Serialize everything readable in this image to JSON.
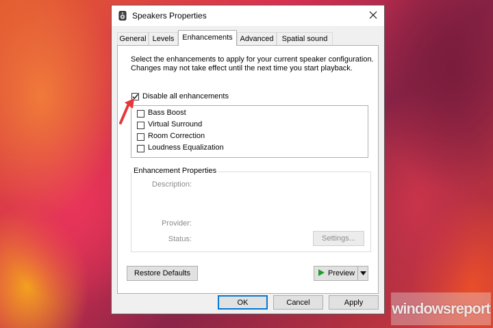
{
  "window": {
    "title": "Speakers Properties",
    "icon": "speaker-icon",
    "close_icon": "close-icon"
  },
  "tabs": [
    {
      "label": "General",
      "active": false
    },
    {
      "label": "Levels",
      "active": false
    },
    {
      "label": "Enhancements",
      "active": true
    },
    {
      "label": "Advanced",
      "active": false
    },
    {
      "label": "Spatial sound",
      "active": false
    }
  ],
  "enhancements": {
    "description": "Select the enhancements to apply for your current speaker configuration. Changes may not take effect until the next time you start playback.",
    "disable_all": {
      "label": "Disable all enhancements",
      "checked": true
    },
    "items": [
      {
        "label": "Bass Boost",
        "checked": false
      },
      {
        "label": "Virtual Surround",
        "checked": false
      },
      {
        "label": "Room Correction",
        "checked": false
      },
      {
        "label": "Loudness Equalization",
        "checked": false
      }
    ]
  },
  "properties": {
    "legend": "Enhancement Properties",
    "description_label": "Description:",
    "provider_label": "Provider:",
    "status_label": "Status:",
    "settings_button": "Settings..."
  },
  "buttons": {
    "restore_defaults": "Restore Defaults",
    "preview": "Preview",
    "ok": "OK",
    "cancel": "Cancel",
    "apply": "Apply"
  },
  "watermark": "windowsreport",
  "colors": {
    "accent": "#0078d7",
    "annotation_arrow": "#e8353a",
    "play_icon": "#1e9e2c"
  }
}
